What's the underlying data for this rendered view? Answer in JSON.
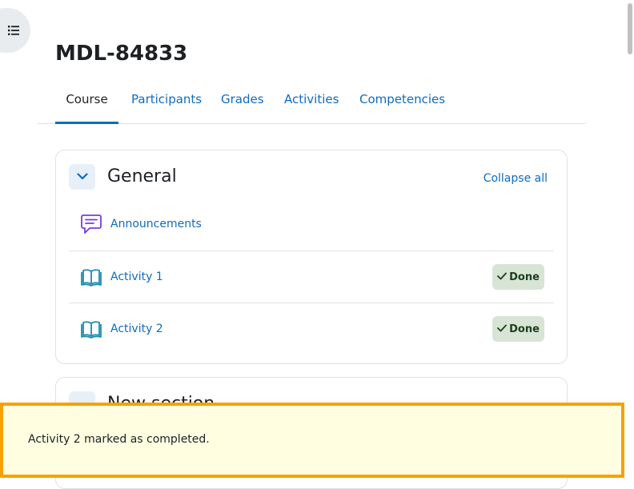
{
  "page": {
    "title": "MDL-84833"
  },
  "tabs": [
    {
      "label": "Course",
      "active": true
    },
    {
      "label": "Participants",
      "active": false
    },
    {
      "label": "Grades",
      "active": false
    },
    {
      "label": "Activities",
      "active": false
    },
    {
      "label": "Competencies",
      "active": false
    }
  ],
  "sections": [
    {
      "title": "General",
      "collapse_all_label": "Collapse all",
      "activities": [
        {
          "name": "Announcements",
          "icon": "forum-icon",
          "completion": ""
        },
        {
          "name": "Activity 1",
          "icon": "book-icon",
          "completion": "Done"
        },
        {
          "name": "Activity 2",
          "icon": "book-icon",
          "completion": "Done"
        }
      ]
    },
    {
      "title": "New section"
    }
  ],
  "toast": {
    "message": "Activity 2 marked as completed."
  },
  "colors": {
    "link": "#0f6cbf",
    "forum_icon": "#7a3cd6",
    "book_icon": "#1e8cae",
    "done_bg": "#d7e4d6",
    "toast_bg": "#fffee0",
    "toast_border": "#f5a200"
  },
  "icons": {
    "drawer_toggle": "list-icon",
    "section_collapse": "chevron-down-icon",
    "done": "check-icon"
  }
}
